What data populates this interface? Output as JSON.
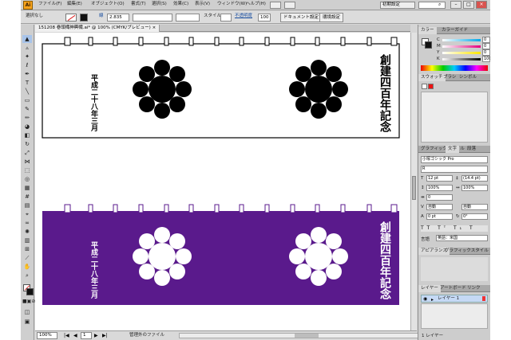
{
  "app": {
    "logo": "Ai"
  },
  "menu": [
    "ファイル(F)",
    "編集(E)",
    "オブジェクト(O)",
    "書式(T)",
    "選択(S)",
    "効果(C)",
    "表示(V)",
    "ウィンドウ(W)",
    "ヘルプ(H)"
  ],
  "workspace": "初期設定",
  "control_bar": {
    "selection": "選択なし",
    "stroke_label": "線",
    "stroke_width": "2.835",
    "style_label": "スタイル",
    "opacity_label": "不透明度",
    "opacity_value": "100",
    "doc_settings_button": "ドキュメント設定",
    "prefs_button": "環境設定"
  },
  "document": {
    "tab_title": "151208 巻頭幟神輿幟.ai* @ 100% (CMYK/プレビュー)"
  },
  "banners": {
    "top": {
      "left_text": "平成二十八年三月",
      "right_text": "創建四百年記念",
      "bg_color": "#ffffff",
      "fg_color": "#000000"
    },
    "bottom": {
      "left_text": "平成二十八年三月",
      "right_text": "創建四百年記念",
      "bg_color": "#5a1a8c",
      "fg_color": "#ffffff"
    }
  },
  "status": {
    "zoom": "100%",
    "page": "1",
    "info": "管理外のファイル"
  },
  "panels": {
    "color": {
      "tabs": [
        "カラー",
        "カラーガイド"
      ],
      "channels": [
        "C",
        "M",
        "Y",
        "K"
      ],
      "values": [
        "0",
        "0",
        "0",
        "100"
      ]
    },
    "swatches": {
      "tabs": [
        "スウォッチ",
        "ブラシ",
        "シンボル"
      ]
    },
    "character": {
      "tabs": [
        "グラフィックスタイル",
        "文字",
        "段落"
      ],
      "font": "小塚ゴシック Pro",
      "style": "R",
      "size": "12 pt",
      "leading": "(14.4 pt)",
      "vscale": "100%",
      "hscale": "100%",
      "tracking": "0",
      "kerning": "自動",
      "baseline": "0 pt",
      "rotation": "0°",
      "language_label": "言語",
      "language": "英語：米国"
    },
    "appearance": {
      "tabs": [
        "アピアランス",
        "グラフィックスタイル"
      ]
    },
    "layers": {
      "tabs": [
        "レイヤー",
        "アートボード",
        "リンク"
      ],
      "layer_name": "レイヤー 1",
      "count": "1 レイヤー"
    }
  },
  "colors": {
    "purple": "#5a1a8c",
    "panel_bg": "#cdcdcd",
    "accent": "#f6a21c"
  }
}
